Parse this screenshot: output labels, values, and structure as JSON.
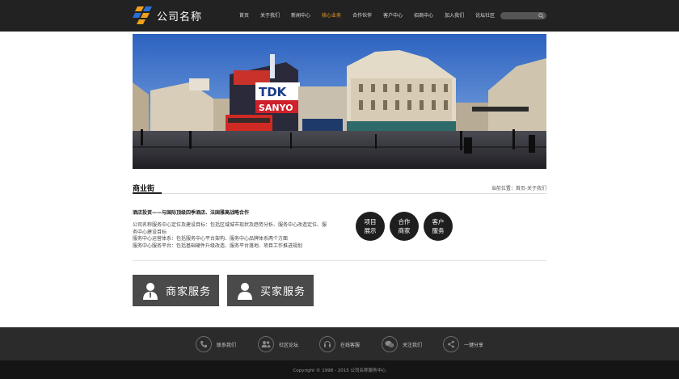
{
  "header": {
    "logo_text": "公司名称",
    "nav": [
      "首页",
      "关于我们",
      "新闻中心",
      "核心业务",
      "合作伙伴",
      "客户中心",
      "招商中心",
      "加入我们",
      "论坛社区"
    ],
    "active_nav_index": 3,
    "search_placeholder": ""
  },
  "section": {
    "title": "商业街",
    "breadcrumb": "当前位置：首页-关于我们"
  },
  "content": {
    "heading": "酒店投资——与国际顶级四季酒店、法国雅高战略合作",
    "paragraphs": [
      "公司名称服务中心定位及建设目标：包括区域城市现状及趋势分析、服务中心改造定位、服务中心建设目标",
      "服务中心运营体系：包括服务中心平台架构、服务中心品牌体系两个方面",
      "服务中心服务平台：包括基础硬件升级改造、服务平台落地、项目工作推进规划"
    ]
  },
  "circles": [
    {
      "line1": "项目",
      "line2": "展示"
    },
    {
      "line1": "合作",
      "line2": "商家"
    },
    {
      "line1": "客户",
      "line2": "服务"
    }
  ],
  "services": {
    "merchant_label": "商家服务",
    "buyer_label": "买家服务"
  },
  "footer": {
    "items": [
      "联系我们",
      "社区论坛",
      "在线客服",
      "关注我们",
      "一键分享"
    ],
    "copyright": "Copyright © 1998 - 2015 公司名称服务中心"
  },
  "colors": {
    "header_bg": "#222222",
    "accent_orange": "#f0a01a",
    "accent_blue": "#2a6fd6",
    "circle_bg": "#1e1e1e",
    "service_bg": "#4a4a4a",
    "footer_bg": "#2b2b2b",
    "copyright_bg": "#151515"
  },
  "icons": {
    "footer": [
      "phone-icon",
      "users-icon",
      "headset-icon",
      "wechat-icon",
      "share-icon"
    ]
  }
}
